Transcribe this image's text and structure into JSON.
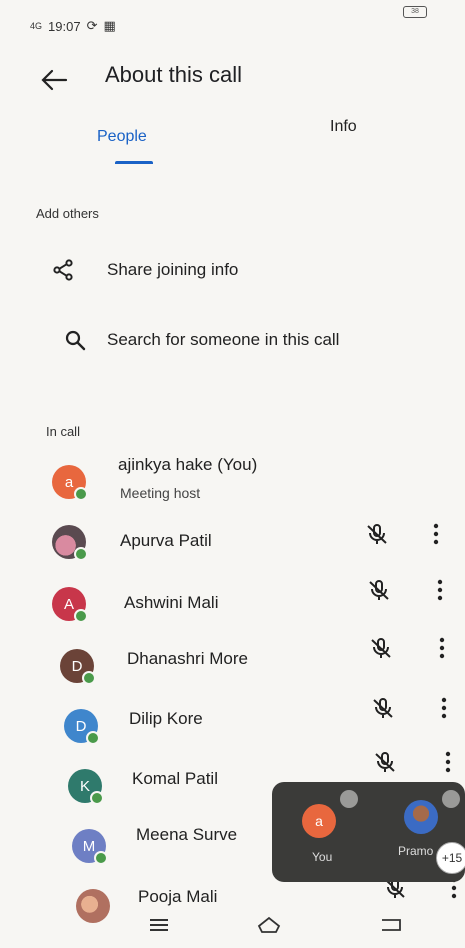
{
  "status": {
    "carrier": "4G",
    "time": "19:07",
    "battery": "38"
  },
  "appbar": {
    "title": "About this call"
  },
  "tabs": [
    {
      "label": "People"
    },
    {
      "label": "Info"
    }
  ],
  "add_others": {
    "heading": "Add others",
    "share_label": "Share joining info",
    "search_label": "Search for someone in this call"
  },
  "in_call": {
    "heading": "In call",
    "host": {
      "initial": "a",
      "name": "ajinkya hake (You)",
      "sub": "Meeting host",
      "color": "#e8673e"
    },
    "people": [
      {
        "initial": "",
        "name": "Apurva Patil",
        "color": "#6a5560"
      },
      {
        "initial": "A",
        "name": "Ashwini Mali",
        "color": "#c8364a"
      },
      {
        "initial": "D",
        "name": "Dhanashri More",
        "color": "#6b4338"
      },
      {
        "initial": "D",
        "name": "Dilip Kore",
        "color": "#3f86cc"
      },
      {
        "initial": "K",
        "name": "Komal Patil",
        "color": "#2f7a6c"
      },
      {
        "initial": "M",
        "name": "Meena Surve",
        "color": "#6e7fc4"
      },
      {
        "initial": "",
        "name": "Pooja Mali",
        "color": "#b07060"
      }
    ]
  },
  "pip": {
    "you_initial": "a",
    "you_label": "You",
    "you_color": "#e8673e",
    "other_label": "Pramo",
    "more": "+15"
  }
}
